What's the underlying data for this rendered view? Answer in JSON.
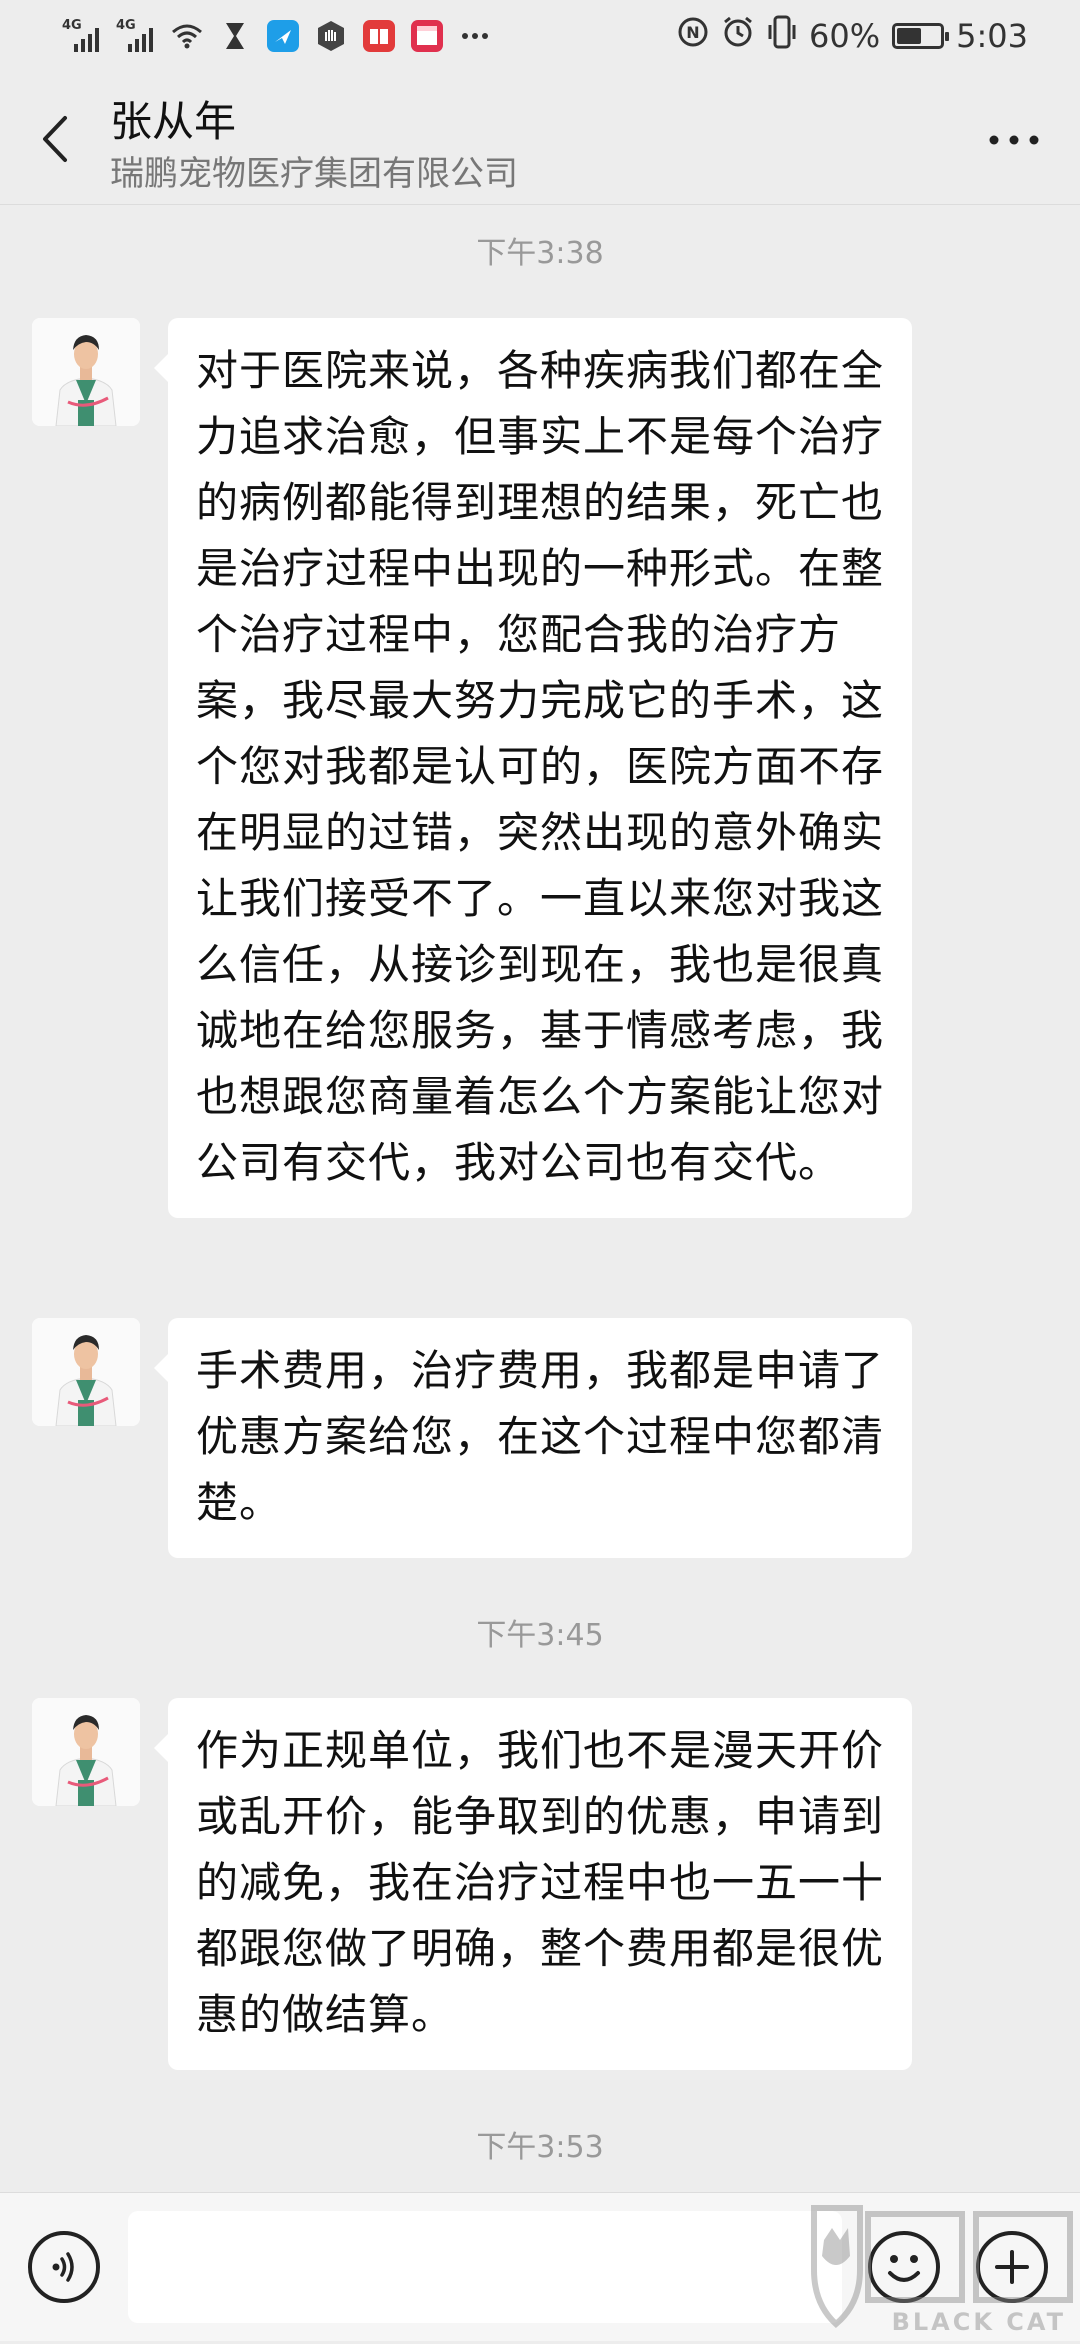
{
  "status_bar": {
    "network_1": "4G",
    "network_2": "4G",
    "battery": "60%",
    "battery_level": 0.6,
    "time": "5:03",
    "icons": [
      "signal-icon",
      "signal-icon",
      "wifi-icon",
      "hourglass-icon",
      "app-notification-icon",
      "hand-icon",
      "book-icon",
      "calendar-icon",
      "more-notifications-icon",
      "nfc-icon",
      "alarm-icon",
      "vibrate-icon",
      "battery-icon"
    ]
  },
  "header": {
    "title": "张从年",
    "subtitle": "瑞鹏宠物医疗集团有限公司"
  },
  "messages": [
    {
      "type": "time",
      "text": "下午3:38"
    },
    {
      "type": "bubble",
      "text": "对于医院来说，各种疾病我们都在全力追求治愈，但事实上不是每个治疗的病例都能得到理想的结果，死亡也是治疗过程中出现的一种形式。在整个治疗过程中，您配合我的治疗方案，我尽最大努力完成它的手术，这个您对我都是认可的，医院方面不存在明显的过错，突然出现的意外确实让我们接受不了。一直以来您对我这么信任，从接诊到现在，我也是很真诚地在给您服务，基于情感考虑，我也想跟您商量着怎么个方案能让您对公司有交代，我对公司也有交代。"
    },
    {
      "type": "bubble",
      "text": "手术费用，治疗费用，我都是申请了优惠方案给您，在这个过程中您都清楚。"
    },
    {
      "type": "time",
      "text": "下午3:45"
    },
    {
      "type": "bubble",
      "text": "作为正规单位，我们也不是漫天开价或乱开价，能争取到的优惠，申请到的减免，我在治疗过程中也一五一十都跟您做了明确，整个费用都是很优惠的做结算。"
    },
    {
      "type": "time",
      "text": "下午3:53"
    }
  ],
  "watermark": {
    "text": "BLACK CAT"
  },
  "colors": {
    "background": "#ededed",
    "bubble": "#ffffff",
    "timestamp": "#999999",
    "scrubs": "#3f8f70"
  }
}
